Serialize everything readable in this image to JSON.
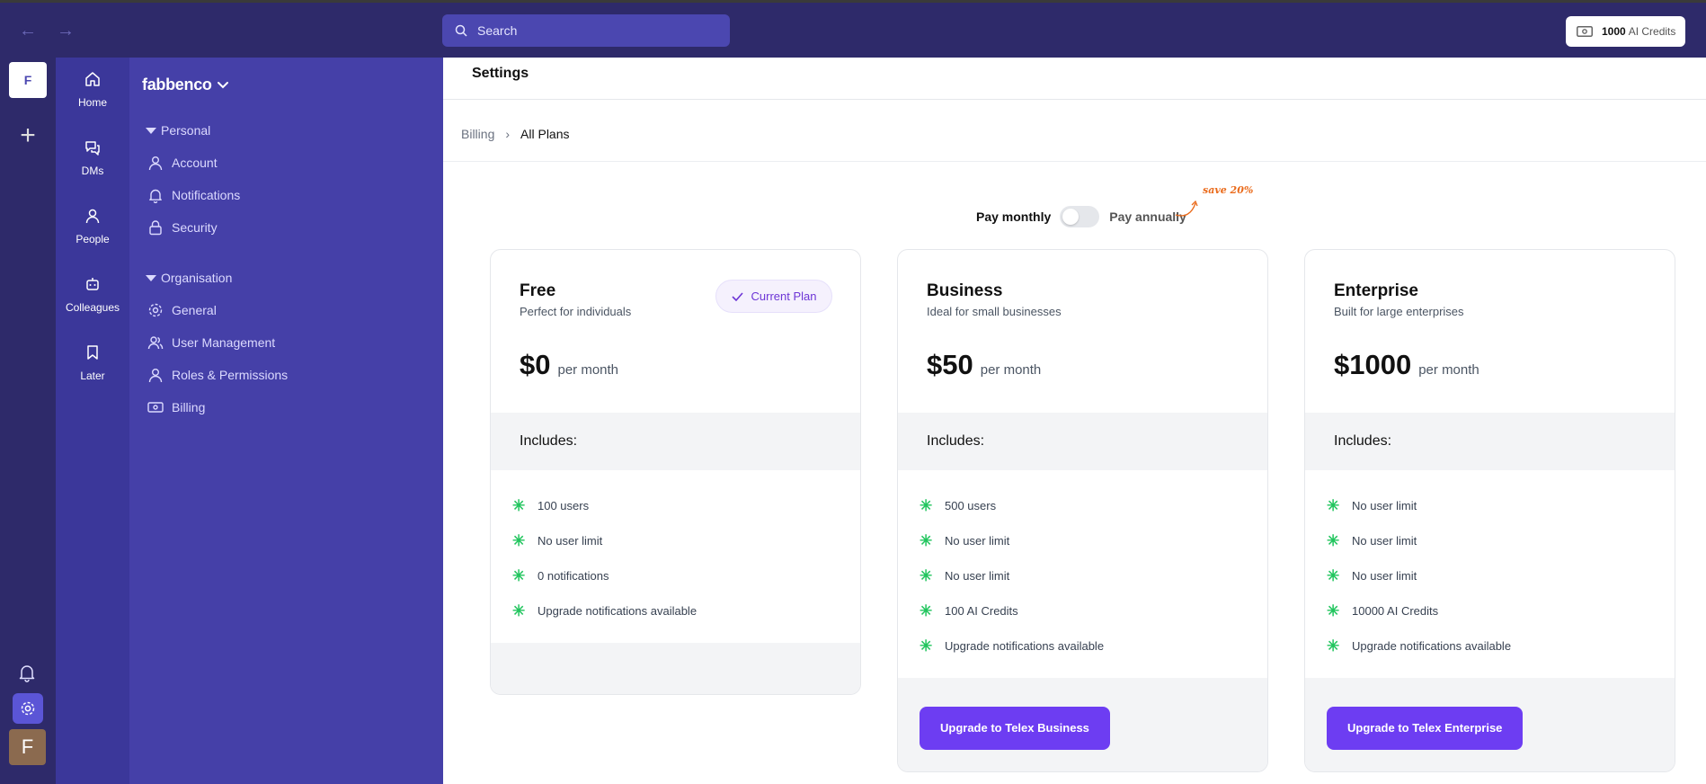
{
  "topbar": {
    "search_placeholder": "Search",
    "credits_amount": "1000",
    "credits_label": "AI Credits"
  },
  "rail": {
    "workspace_initial": "F",
    "avatar_initial": "F"
  },
  "main_nav": [
    {
      "label": "Home",
      "icon": "home-icon"
    },
    {
      "label": "DMs",
      "icon": "chat-icon"
    },
    {
      "label": "People",
      "icon": "person-icon"
    },
    {
      "label": "Colleagues",
      "icon": "robot-icon"
    },
    {
      "label": "Later",
      "icon": "bookmark-icon"
    }
  ],
  "sidebar": {
    "workspace_name": "fabbenco",
    "personal_section": "Personal",
    "personal_items": [
      {
        "label": "Account",
        "icon": "user-icon"
      },
      {
        "label": "Notifications",
        "icon": "bell-icon"
      },
      {
        "label": "Security",
        "icon": "lock-icon"
      }
    ],
    "org_section": "Organisation",
    "org_items": [
      {
        "label": "General",
        "icon": "gear-icon"
      },
      {
        "label": "User Management",
        "icon": "users-icon"
      },
      {
        "label": "Roles & Permissions",
        "icon": "user-icon"
      },
      {
        "label": "Billing",
        "icon": "billing-icon"
      }
    ]
  },
  "page": {
    "title": "Settings",
    "breadcrumb": [
      "Billing",
      "All Plans"
    ]
  },
  "billing_toggle": {
    "left_label": "Pay monthly",
    "right_label": "Pay annually",
    "annual_selected": false,
    "save_note": "save 20%"
  },
  "plans": [
    {
      "name": "Free",
      "description": "Perfect for individuals",
      "price": "$0",
      "period": "per month",
      "current_label": "Current Plan",
      "includes_label": "Includes:",
      "features": [
        "100 users",
        "No user limit",
        "0 notifications",
        "Upgrade notifications available"
      ]
    },
    {
      "name": "Business",
      "description": "Ideal for small businesses",
      "price": "$50",
      "period": "per month",
      "includes_label": "Includes:",
      "features": [
        "500 users",
        "No user limit",
        "No user limit",
        "100 AI Credits",
        "Upgrade notifications available"
      ],
      "cta": "Upgrade to Telex Business"
    },
    {
      "name": "Enterprise",
      "description": "Built for large enterprises",
      "price": "$1000",
      "period": "per month",
      "includes_label": "Includes:",
      "features": [
        "No user limit",
        "No user limit",
        "No user limit",
        "10000 AI Credits",
        "Upgrade notifications available"
      ],
      "cta": "Upgrade to Telex Enterprise"
    }
  ],
  "colors": {
    "rail": "#2e2a6a",
    "main_nav": "#3b379a",
    "sidebar": "#4540a8",
    "accent": "#6d3df2",
    "feature_star": "#22c55e",
    "save_note": "#ea6a1a"
  }
}
